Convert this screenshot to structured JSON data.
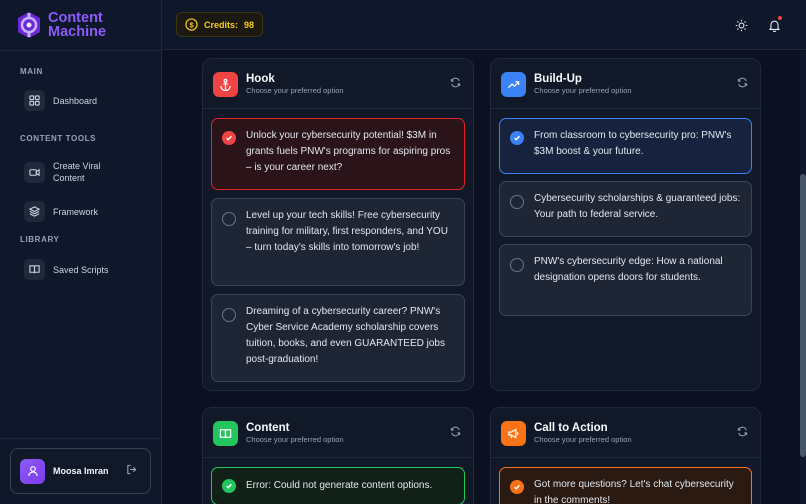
{
  "brand": {
    "line1": "Content",
    "line2": "Machine"
  },
  "sidebar": {
    "sections": [
      {
        "label": "MAIN"
      },
      {
        "label": "CONTENT TOOLS"
      },
      {
        "label": "LIBRARY"
      }
    ],
    "items": [
      {
        "label": "Dashboard",
        "icon": "grid-icon"
      },
      {
        "label": "Create Viral Content",
        "icon": "video-icon"
      },
      {
        "label": "Framework",
        "icon": "layers-icon"
      },
      {
        "label": "Saved Scripts",
        "icon": "book-icon"
      }
    ],
    "user": {
      "name": "Moosa Imran"
    }
  },
  "header": {
    "credits_label": "Credits:",
    "credits_value": "98"
  },
  "colors": {
    "accent": "#8b5cf6",
    "hook": "#ef4444",
    "buildup": "#3b82f6",
    "content": "#22c55e",
    "cta": "#f97316"
  },
  "panels": {
    "hook": {
      "title": "Hook",
      "subtitle": "Choose your preferred option",
      "options": [
        {
          "text": "Unlock your cybersecurity potential! $3M in grants fuels PNW's programs for aspiring pros – is your career next?",
          "selected": true
        },
        {
          "text": "Level up your tech skills! Free cybersecurity training for military, first responders, and YOU – turn today's skills into tomorrow's job!",
          "selected": false
        },
        {
          "text": "Dreaming of a cybersecurity career? PNW's Cyber Service Academy scholarship covers tuition, books, and even GUARANTEED jobs post-graduation!",
          "selected": false
        }
      ]
    },
    "buildup": {
      "title": "Build-Up",
      "subtitle": "Choose your preferred option",
      "options": [
        {
          "text": "From classroom to cybersecurity pro: PNW's $3M boost & your future.",
          "selected": true
        },
        {
          "text": "Cybersecurity scholarships & guaranteed jobs: Your path to federal service.",
          "selected": false
        },
        {
          "text": "PNW's cybersecurity edge: How a national designation opens doors for students.",
          "selected": false
        }
      ]
    },
    "content": {
      "title": "Content",
      "subtitle": "Choose your preferred option",
      "options": [
        {
          "text": "Error: Could not generate content options.",
          "selected": true
        }
      ]
    },
    "cta": {
      "title": "Call to Action",
      "subtitle": "Choose your preferred option",
      "options": [
        {
          "text": "Got more questions? Let's chat cybersecurity in the comments!",
          "selected": true
        }
      ]
    }
  }
}
